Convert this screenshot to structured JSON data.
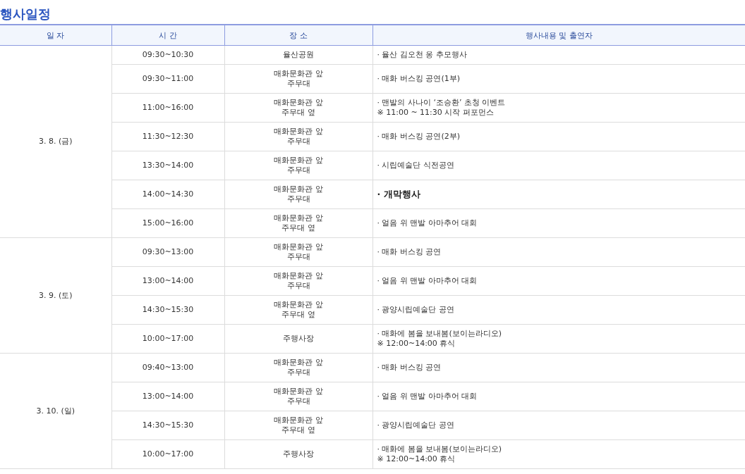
{
  "title": "행사일정",
  "table": {
    "columns": [
      "일 자",
      "시 간",
      "장 소",
      "행사내용 및 출연자"
    ],
    "days": [
      {
        "date": "3. 8. (금)",
        "events": [
          {
            "time": "09:30~10:30",
            "place": [
              "율산공원"
            ],
            "content": [
              "· 율산 김오천 옹 추모행사"
            ],
            "bold": false
          },
          {
            "time": "09:30~11:00",
            "place": [
              "매화문화관 앞",
              "주무대"
            ],
            "content": [
              "· 매화 버스킹 공연(1부)"
            ],
            "bold": false
          },
          {
            "time": "11:00~16:00",
            "place": [
              "매화문화관 앞",
              "주무대 옆"
            ],
            "content": [
              "· 맨발의 사나이 ‘조승환’ 초청 이벤트",
              "※ 11:00 ~ 11:30 시작 퍼포먼스"
            ],
            "bold": false
          },
          {
            "time": "11:30~12:30",
            "place": [
              "매화문화관 앞",
              "주무대"
            ],
            "content": [
              "· 매화 버스킹 공연(2부)"
            ],
            "bold": false
          },
          {
            "time": "13:30~14:00",
            "place": [
              "매화문화관 앞",
              "주무대"
            ],
            "content": [
              "· 시립예술단 식전공연"
            ],
            "bold": false
          },
          {
            "time": "14:00~14:30",
            "place": [
              "매화문화관 앞",
              "주무대"
            ],
            "content": [
              "· 개막행사"
            ],
            "bold": true
          },
          {
            "time": "15:00~16:00",
            "place": [
              "매화문화관 앞",
              "주무대 옆"
            ],
            "content": [
              "· 얼음 위 맨발 아마추어 대회"
            ],
            "bold": false
          }
        ]
      },
      {
        "date": "3. 9. (토)",
        "events": [
          {
            "time": "09:30~13:00",
            "place": [
              "매화문화관 앞",
              "주무대"
            ],
            "content": [
              "· 매화 버스킹 공연"
            ],
            "bold": false
          },
          {
            "time": "13:00~14:00",
            "place": [
              "매화문화관 앞",
              "주무대"
            ],
            "content": [
              "· 얼음 위 맨발 아마추어 대회"
            ],
            "bold": false
          },
          {
            "time": "14:30~15:30",
            "place": [
              "매화문화관 앞",
              "주무대 옆"
            ],
            "content": [
              "· 광양시립예술단 공연"
            ],
            "bold": false
          },
          {
            "time": "10:00~17:00",
            "place": [
              "주행사장"
            ],
            "content": [
              "· 매화에 봄을 보내봄(보이는라디오)",
              "※ 12:00~14:00 휴식"
            ],
            "bold": false
          }
        ]
      },
      {
        "date": "3. 10. (일)",
        "events": [
          {
            "time": "09:40~13:00",
            "place": [
              "매화문화관 앞",
              "주무대"
            ],
            "content": [
              "· 매화 버스킹 공연"
            ],
            "bold": false
          },
          {
            "time": "13:00~14:00",
            "place": [
              "매화문화관 앞",
              "주무대"
            ],
            "content": [
              "· 얼음 위 맨발 아마추어 대회"
            ],
            "bold": false
          },
          {
            "time": "14:30~15:30",
            "place": [
              "매화문화관 앞",
              "주무대 옆"
            ],
            "content": [
              "· 광양시립예술단 공연"
            ],
            "bold": false
          },
          {
            "time": "10:00~17:00",
            "place": [
              "주행사장"
            ],
            "content": [
              "· 매화에 봄을 보내봄(보이는라디오)",
              "※ 12:00~14:00 휴식"
            ],
            "bold": false
          }
        ]
      }
    ]
  }
}
